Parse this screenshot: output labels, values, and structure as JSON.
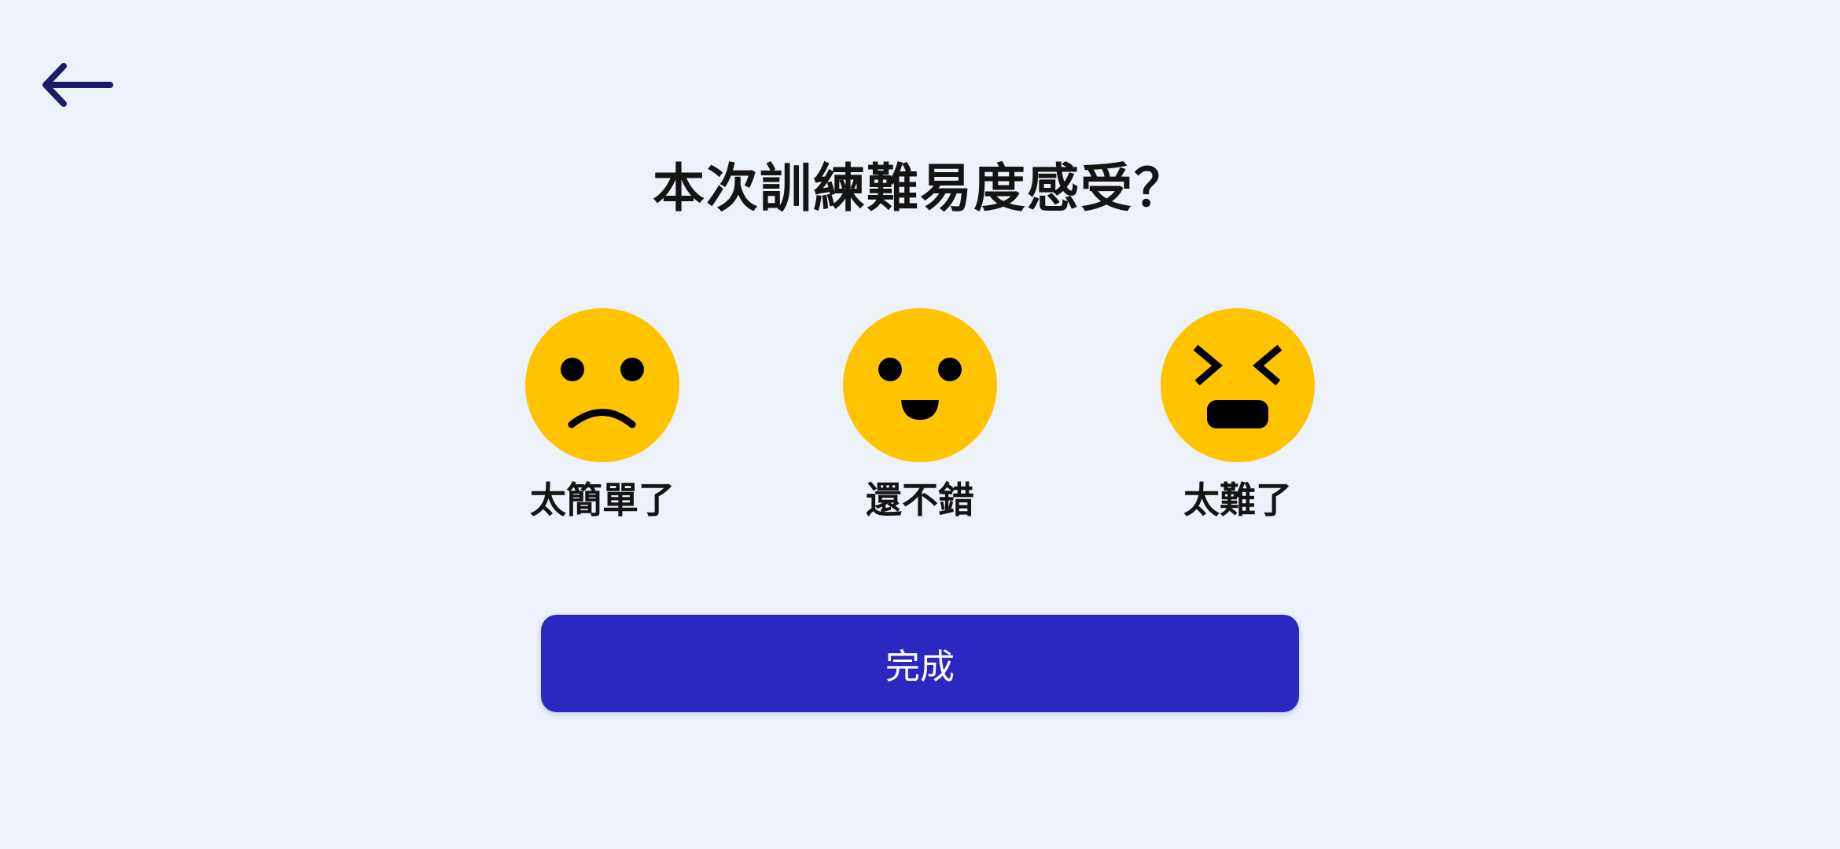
{
  "header": {
    "back_icon": "arrow-left-icon"
  },
  "title": "本次訓練難易度感受？",
  "options": [
    {
      "label": "太簡單了",
      "icon": "sad-face-icon"
    },
    {
      "label": "還不錯",
      "icon": "happy-face-icon"
    },
    {
      "label": "太難了",
      "icon": "struggling-face-icon"
    }
  ],
  "done_button": {
    "label": "完成"
  },
  "colors": {
    "background": "#edf2fa",
    "accent": "#2b28c2",
    "face": "#ffc300",
    "back_icon": "#1f1b66",
    "text": "#141414"
  }
}
